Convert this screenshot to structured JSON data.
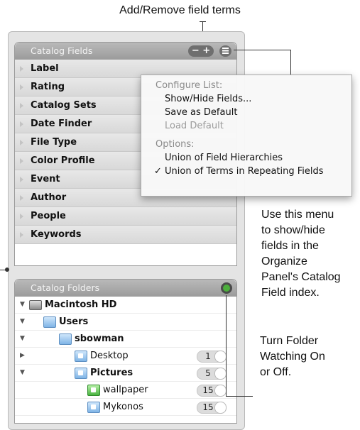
{
  "callouts": {
    "top": "Add/Remove field terms",
    "menu_note": [
      "Use this menu",
      "to show/hide",
      "fields in the",
      "Organize",
      "Panel's Catalog",
      "Field index."
    ],
    "watch_note": [
      "Turn Folder",
      "Watching On",
      "or Off."
    ]
  },
  "catalog_fields": {
    "title": "Catalog Fields",
    "remove_label": "−",
    "add_label": "+",
    "fields": [
      "Label",
      "Rating",
      "Catalog Sets",
      "Date Finder",
      "File Type",
      "Color Profile",
      "Event",
      "Author",
      "People",
      "Keywords"
    ]
  },
  "menu": {
    "section_configure": "Configure List:",
    "show_hide": "Show/Hide Fields...",
    "save_default": "Save as Default",
    "load_default": "Load Default",
    "section_options": "Options:",
    "union_hierarchies": "Union of Field Hierarchies",
    "union_terms": "Union of Terms in Repeating Fields",
    "checkmark": "✓"
  },
  "catalog_folders": {
    "title": "Catalog Folders",
    "rows": [
      {
        "name": "Macintosh HD",
        "icon": "hard-drive-icon",
        "expanded": true,
        "bold": true,
        "count": ""
      },
      {
        "name": "Users",
        "icon": "folder-icon",
        "expanded": true,
        "bold": true,
        "count": ""
      },
      {
        "name": "sbowman",
        "icon": "folder-icon",
        "expanded": true,
        "bold": true,
        "count": ""
      },
      {
        "name": "Desktop",
        "icon": "folder-icon",
        "expanded": false,
        "bold": false,
        "count": "1"
      },
      {
        "name": "Pictures",
        "icon": "folder-icon",
        "expanded": true,
        "bold": true,
        "count": "5"
      },
      {
        "name": "wallpaper",
        "icon": "watched-folder-icon",
        "expanded": false,
        "bold": false,
        "count": "15"
      },
      {
        "name": "Mykonos",
        "icon": "folder-icon",
        "expanded": false,
        "bold": false,
        "count": "15"
      }
    ]
  },
  "colors": {
    "header": "#a8a8a8",
    "watch_button": "#4caf3c"
  }
}
